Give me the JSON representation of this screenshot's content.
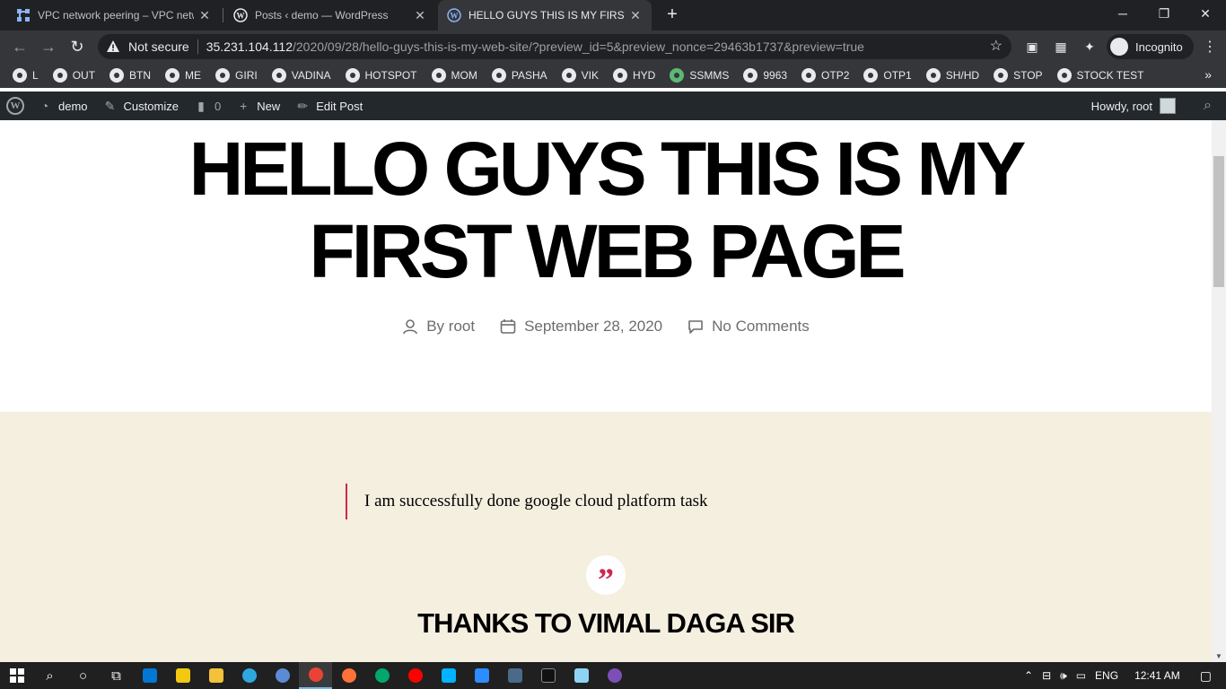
{
  "browser": {
    "tabs": [
      {
        "title": "VPC network peering – VPC netw",
        "icon": "gcp-icon"
      },
      {
        "title": "Posts ‹ demo — WordPress",
        "icon": "wordpress-icon"
      },
      {
        "title": "HELLO GUYS THIS IS MY FIRST W",
        "icon": "wordpress-icon"
      }
    ],
    "security_label": "Not secure",
    "url_host": "35.231.104.112",
    "url_path": "/2020/09/28/hello-guys-this-is-my-web-site/?preview_id=5&preview_nonce=29463b1737&preview=true",
    "incognito_label": "Incognito",
    "bookmarks": [
      "L",
      "OUT",
      "BTN",
      "ME",
      "GIRI",
      "VADINA",
      "HOTSPOT",
      "MOM",
      "PASHA",
      "VIK",
      "HYD",
      "SSMMS",
      "9963",
      "OTP2",
      "OTP1",
      "SH/HD",
      "STOP",
      "STOCK TEST"
    ]
  },
  "adminbar": {
    "site": "demo",
    "customize": "Customize",
    "comments_count": "0",
    "new": "New",
    "edit_post": "Edit Post",
    "howdy": "Howdy, root"
  },
  "post": {
    "title_line1": "HELLO GUYS THIS IS MY",
    "title_line2": "FIRST WEB PAGE",
    "author": "By root",
    "date": "September 28, 2020",
    "comments": "No Comments",
    "quote": "I am successfully done google cloud platform task",
    "heading": "THANKS TO VIMAL DAGA SIR"
  },
  "taskbar": {
    "language": "ENG",
    "time": "12:41 AM"
  },
  "colors": {
    "accent": "#cd2653",
    "beige": "#f5efe0",
    "adminbar": "#23282d",
    "chrome_dark": "#202124"
  }
}
